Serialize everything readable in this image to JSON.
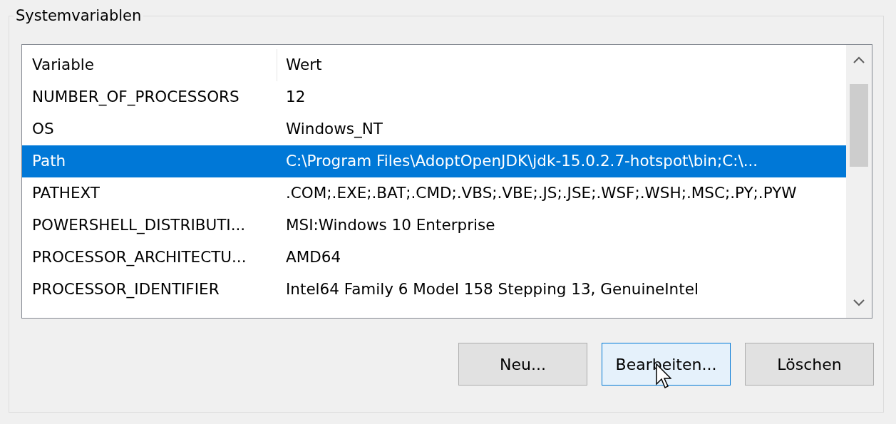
{
  "group": {
    "title": "Systemvariablen"
  },
  "table": {
    "columns": [
      "Variable",
      "Wert"
    ],
    "rows": [
      {
        "variable": "NUMBER_OF_PROCESSORS",
        "value": "12",
        "selected": false
      },
      {
        "variable": "OS",
        "value": "Windows_NT",
        "selected": false
      },
      {
        "variable": "Path",
        "value": "C:\\Program Files\\AdoptOpenJDK\\jdk-15.0.2.7-hotspot\\bin;C:\\...",
        "selected": true
      },
      {
        "variable": "PATHEXT",
        "value": ".COM;.EXE;.BAT;.CMD;.VBS;.VBE;.JS;.JSE;.WSF;.WSH;.MSC;.PY;.PYW",
        "selected": false
      },
      {
        "variable": "POWERSHELL_DISTRIBUTI...",
        "value": "MSI:Windows 10 Enterprise",
        "selected": false
      },
      {
        "variable": "PROCESSOR_ARCHITECTU...",
        "value": "AMD64",
        "selected": false
      },
      {
        "variable": "PROCESSOR_IDENTIFIER",
        "value": "Intel64 Family 6 Model 158 Stepping 13, GenuineIntel",
        "selected": false
      }
    ]
  },
  "buttons": [
    {
      "label": "Neu...",
      "hovered": false
    },
    {
      "label": "Bearbeiten...",
      "hovered": true
    },
    {
      "label": "Löschen",
      "hovered": false
    }
  ]
}
